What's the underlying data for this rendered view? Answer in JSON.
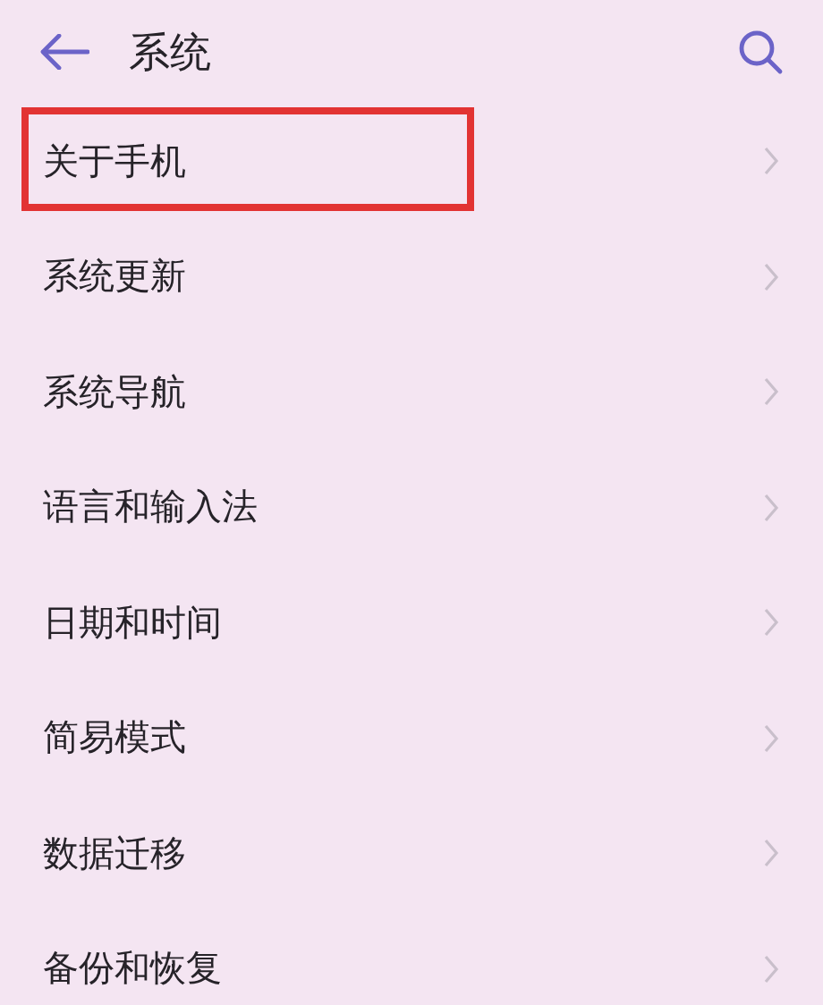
{
  "header": {
    "title": "系统"
  },
  "items": [
    {
      "label": "关于手机",
      "highlighted": true
    },
    {
      "label": "系统更新",
      "highlighted": false
    },
    {
      "label": "系统导航",
      "highlighted": false
    },
    {
      "label": "语言和输入法",
      "highlighted": false
    },
    {
      "label": "日期和时间",
      "highlighted": false
    },
    {
      "label": "简易模式",
      "highlighted": false
    },
    {
      "label": "数据迁移",
      "highlighted": false
    },
    {
      "label": "备份和恢复",
      "highlighted": false
    }
  ]
}
